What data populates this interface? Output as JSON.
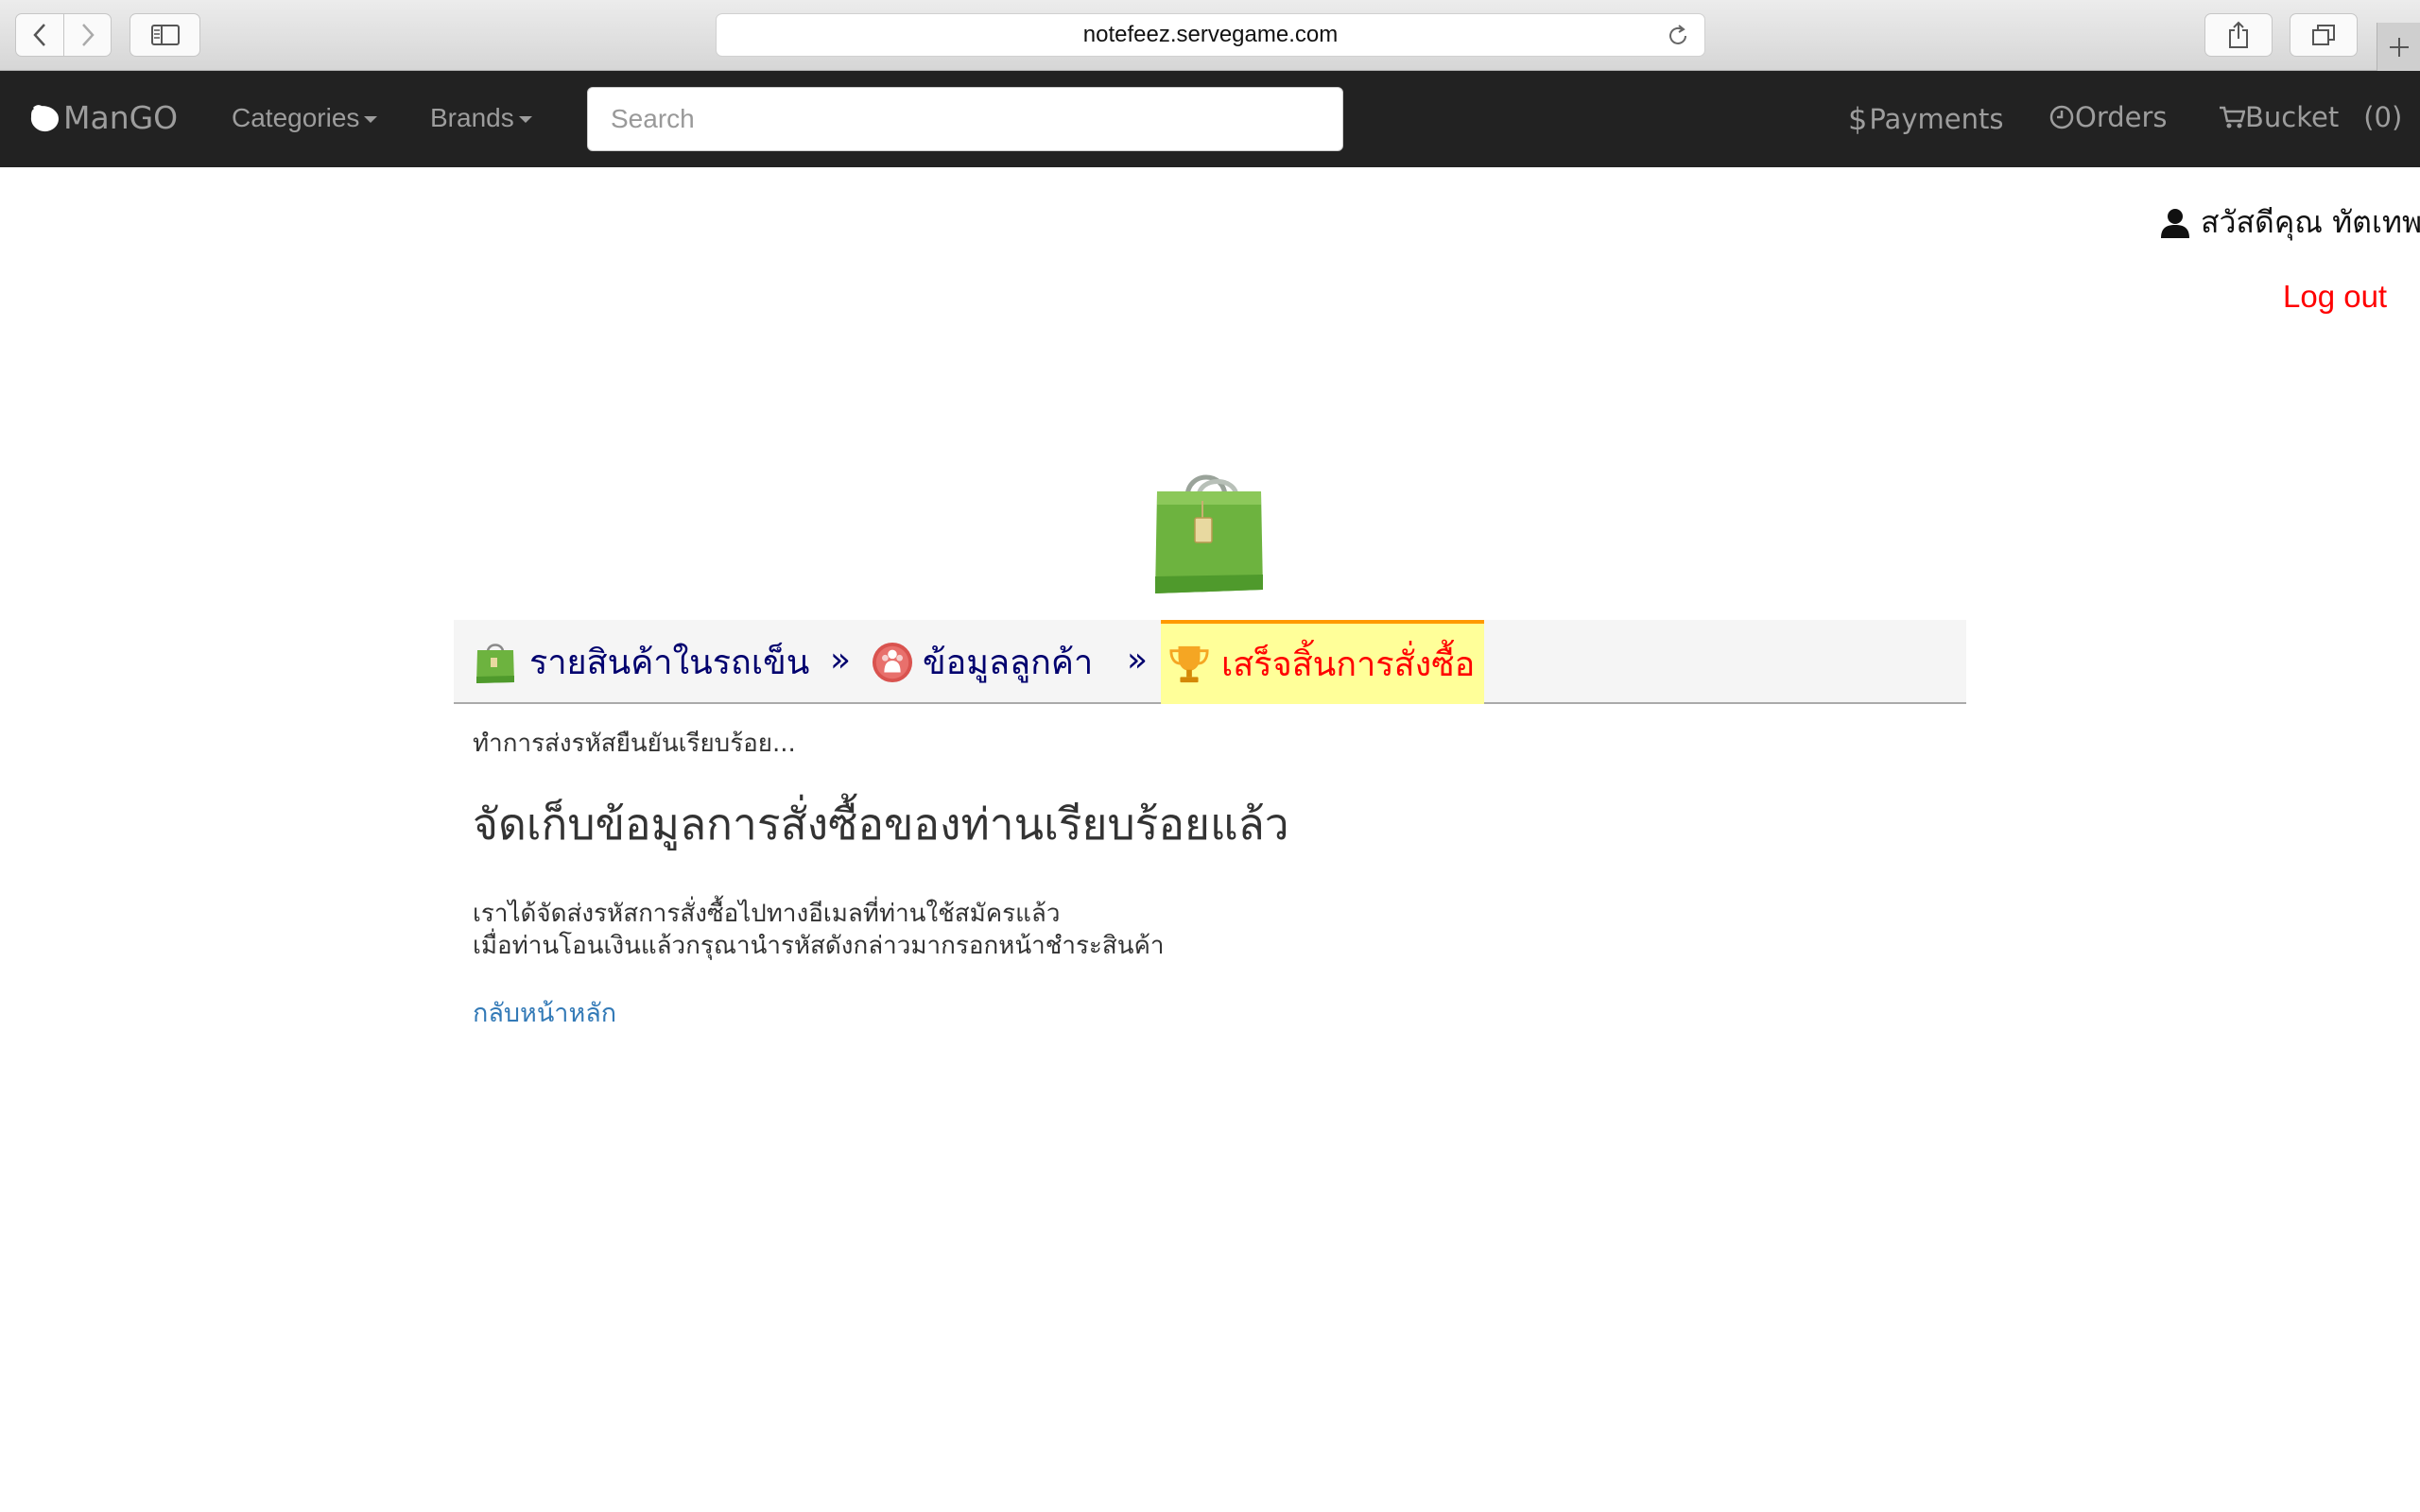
{
  "browser": {
    "url": "notefeez.servegame.com"
  },
  "navbar": {
    "brand": "ManGO",
    "categories": "Categories",
    "brands": "Brands",
    "search_placeholder": "Search",
    "payments": "Payments",
    "orders": "Orders",
    "bucket": "Bucket",
    "bucket_count": "(0)"
  },
  "user": {
    "greeting": "สวัสดีคุณ ทัตเทพ",
    "logout": "Log out"
  },
  "steps": {
    "step1": "รายสินค้าในรถเข็น",
    "sep": "»",
    "step2": "ข้อมูลลูกค้า",
    "step3": "เสร็จสิ้นการสั่งซื้อ"
  },
  "content": {
    "sent_note": "ทำการส่งรหัสยืนยันเรียบร้อย...",
    "headline": "จัดเก็บข้อมูลการสั่งซื้อของท่านเรียบร้อยแล้ว",
    "line1": "เราได้จัดส่งรหัสการสั่งซื้อไปทางอีเมลที่ท่านใช้สมัครแล้ว",
    "line2": "เมื่อท่านโอนเงินแล้วกรุณานำรหัสดังกล่าวมากรอกหน้าชำระสินค้า",
    "home_link": "กลับหน้าหลัก"
  },
  "colors": {
    "navbar_bg": "#222222",
    "logout": "#ff0000",
    "step_active_bg": "#ffff99",
    "step_active_text": "#ff0000",
    "step_text": "#00006e",
    "link": "#337ab7"
  }
}
